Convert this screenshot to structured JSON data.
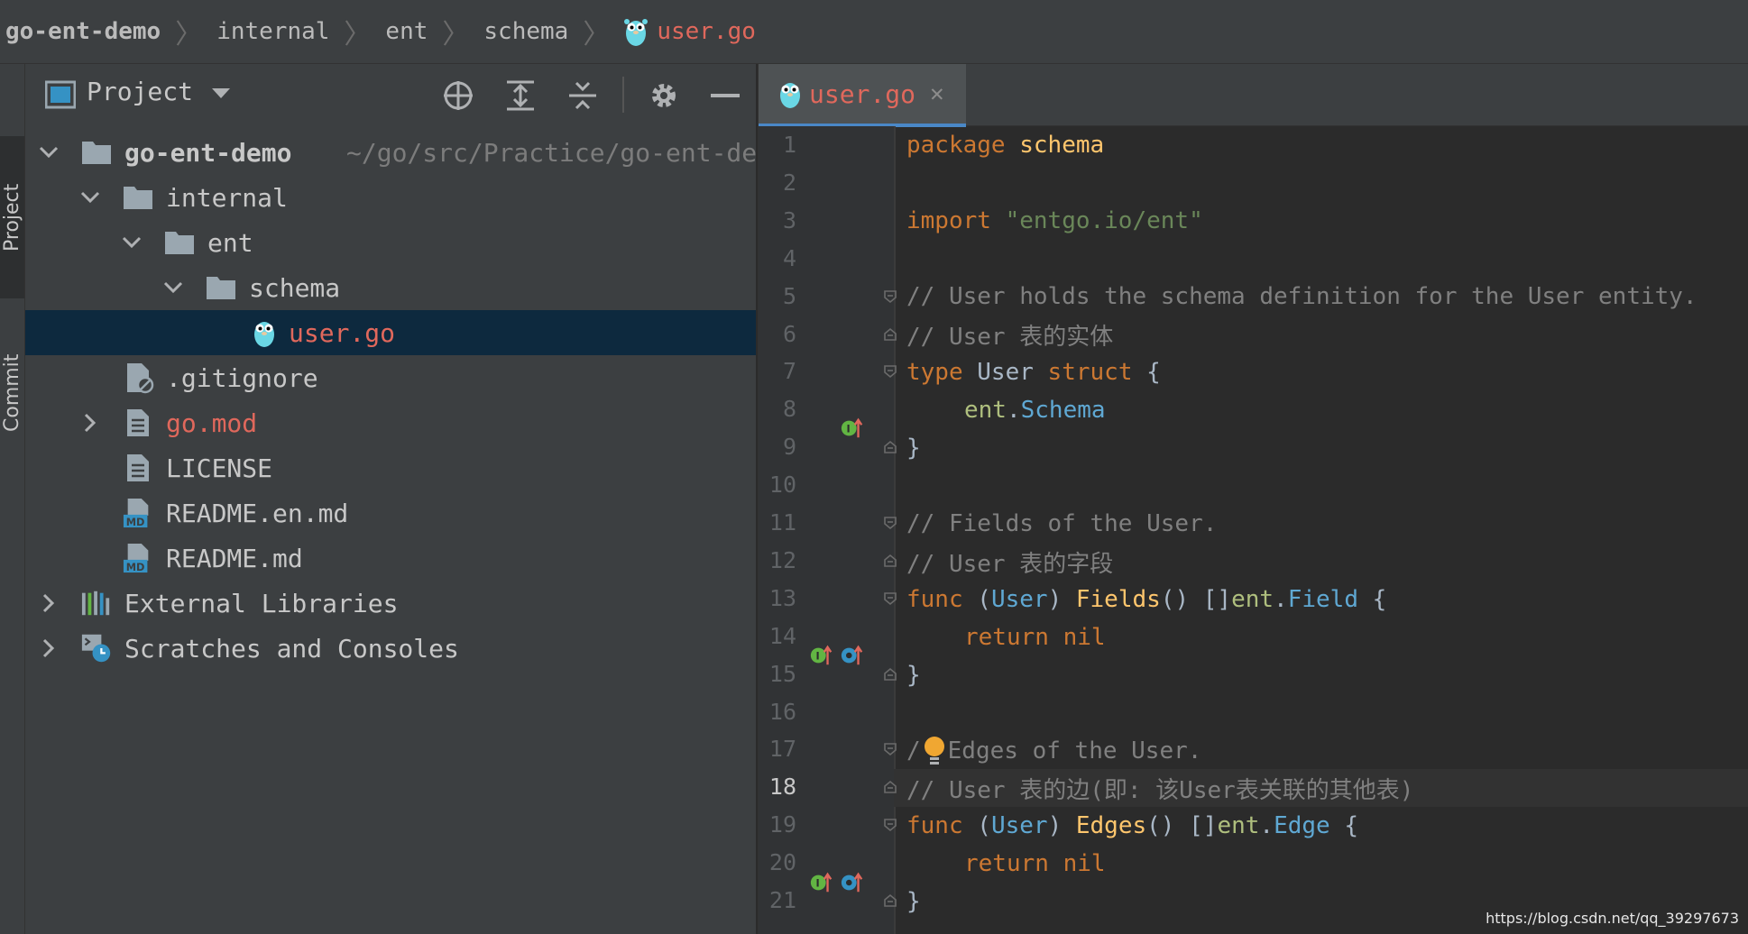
{
  "breadcrumb": {
    "items": [
      "go-ent-demo",
      "internal",
      "ent",
      "schema",
      "user.go"
    ]
  },
  "left_strip": {
    "project_tab": "Project",
    "commit_tab": "Commit"
  },
  "project_panel": {
    "title": "Project",
    "tree": [
      {
        "label": "go-ent-demo",
        "path": "~/go/src/Practice/go-ent-demo"
      },
      {
        "label": "internal"
      },
      {
        "label": "ent"
      },
      {
        "label": "schema"
      },
      {
        "label": "user.go"
      },
      {
        "label": ".gitignore"
      },
      {
        "label": "go.mod"
      },
      {
        "label": "LICENSE"
      },
      {
        "label": "README.en.md"
      },
      {
        "label": "README.md"
      },
      {
        "label": "External Libraries"
      },
      {
        "label": "Scratches and Consoles"
      }
    ]
  },
  "editor": {
    "tab_label": "user.go",
    "current_line": 18,
    "line_numbers": [
      "1",
      "2",
      "3",
      "4",
      "5",
      "6",
      "7",
      "8",
      "9",
      "10",
      "11",
      "12",
      "13",
      "14",
      "15",
      "16",
      "17",
      "18",
      "19",
      "20",
      "21"
    ],
    "lines": {
      "l1_kw": "package",
      "l1_name": " schema",
      "l3_kw": "import",
      "l3_str": " \"entgo.io/ent\"",
      "l5": "// User holds the schema definition for the User entity.",
      "l6": "// User 表的实体",
      "l7_kw": "type",
      "l7_name": " User ",
      "l7_kw2": "struct",
      "l7_rest": " {",
      "l8_pkg": "ent",
      "l8_dot": ".",
      "l8_type": "Schema",
      "l9": "}",
      "l11": "// Fields of the User.",
      "l12": "// User 表的字段",
      "l13_kw": "func",
      "l13_a": " (",
      "l13_recv": "User",
      "l13_b": ") ",
      "l13_fn": "Fields",
      "l13_c": "() []",
      "l13_pkg": "ent",
      "l13_dot": ".",
      "l13_type": "Field",
      "l13_d": " {",
      "l14_kw": "return",
      "l14_nil": " nil",
      "l15": "}",
      "l17_a": "/",
      "l17_b": "Edges of the User.",
      "l18": "// User 表的边(即: 该User表关联的其他表)",
      "l19_kw": "func",
      "l19_a": " (",
      "l19_recv": "User",
      "l19_b": ") ",
      "l19_fn": "Edges",
      "l19_c": "() []",
      "l19_pkg": "ent",
      "l19_dot": ".",
      "l19_type": "Edge",
      "l19_d": " {",
      "l20_kw": "return",
      "l20_nil": " nil",
      "l21": "}"
    }
  },
  "watermark": "https://blog.csdn.net/qq_39297673",
  "colors": {
    "keyword": "#cc7832",
    "function": "#ffc66d",
    "string": "#6a8759",
    "comment": "#808080",
    "selection": "#0d293e",
    "tab_underline": "#4a88c7",
    "modified_file": "#e0685c"
  }
}
